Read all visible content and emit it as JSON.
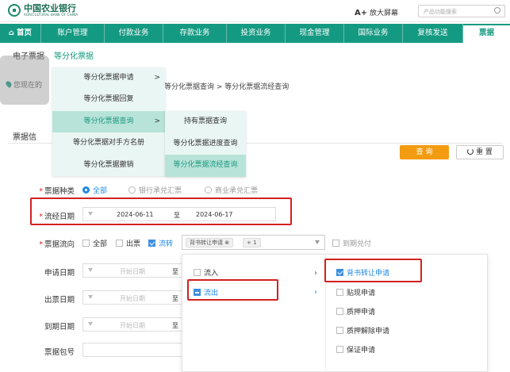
{
  "header": {
    "logo_cn": "中国农业银行",
    "logo_en": "AGRICULTURAL BANK OF CHINA",
    "enlarge_a": "A+",
    "enlarge_label": "放大屏幕",
    "search_placeholder": "产品功能搜索"
  },
  "main_nav": {
    "items": [
      "首页",
      "账户管理",
      "付款业务",
      "存款业务",
      "投资业务",
      "现金管理",
      "国际业务",
      "复核发送",
      "票据"
    ]
  },
  "sub_nav": {
    "item": "电子票据",
    "active": "等分化票据"
  },
  "breadcrumb": {
    "prefix": "您现在的",
    "rest": "等分化票据查询 > 等分化票据流经查询"
  },
  "menu_level1": {
    "items": [
      "等分化票据申请",
      "等分化票据回复",
      "等分化票据查询",
      "等分化票据对手方名册",
      "等分化票据撤销"
    ],
    "arrow": ">"
  },
  "menu_level2": {
    "items": [
      "持有票据查询",
      "等分化票据进度查询",
      "等分化票据流经查询"
    ]
  },
  "section": {
    "title": "票据信"
  },
  "buttons": {
    "query": "查 询",
    "reset": "重 置"
  },
  "form": {
    "bill_type": {
      "label": "票据种类",
      "options": [
        "全部",
        "银行承兑汇票",
        "商业承兑汇票"
      ],
      "selected": "全部"
    },
    "flow_date": {
      "label": "流经日期",
      "start": "2024-06-11",
      "sep": "至",
      "end": "2024-06-17"
    },
    "flow_direction": {
      "label": "票据流向",
      "options": [
        "全部",
        "出票",
        "流转"
      ],
      "checked": [
        "流转"
      ],
      "tag": "背书转让申请",
      "tag_count": "+ 1",
      "extra_option": "到期兑付"
    },
    "apply_date": {
      "label": "申请日期",
      "placeholder": "开始日期",
      "sep": "至"
    },
    "issue_date": {
      "label": "出票日期",
      "placeholder": "开始日期",
      "sep": "至"
    },
    "due_date": {
      "label": "到期日期",
      "placeholder": "开始日期",
      "sep": "至"
    },
    "package_no": {
      "label": "票据包号"
    }
  },
  "cascader": {
    "left": [
      "流入",
      "流出"
    ],
    "right": [
      "背书转让申请",
      "贴现申请",
      "质押申请",
      "质押解除申请",
      "保证申请"
    ],
    "right_checked": "背书转让申请"
  },
  "colors": {
    "brand": "#149a82",
    "query_button": "#f39c12",
    "highlight": "#d32020",
    "checkbox": "#3d8fe0"
  }
}
